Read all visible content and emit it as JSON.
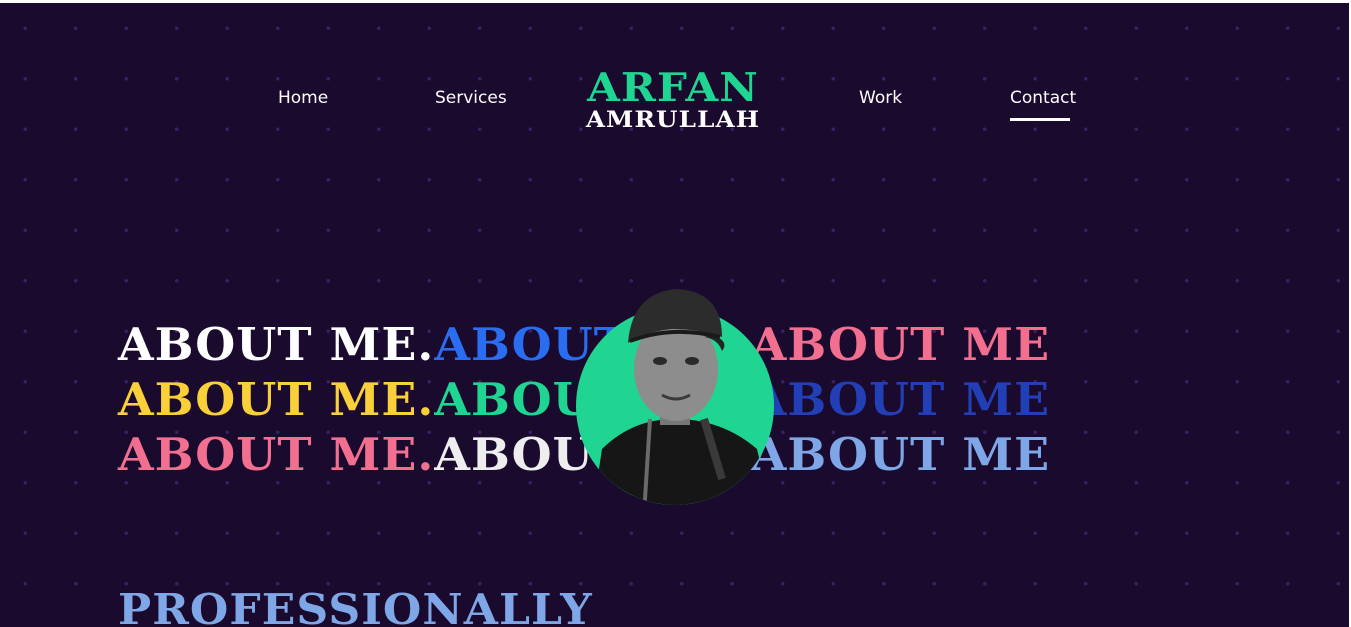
{
  "nav": {
    "links": [
      "Home",
      "Services",
      "Work",
      "Contact"
    ],
    "active": "Contact"
  },
  "logo": {
    "line1": "ARFAN",
    "line2": "AMRULLAH"
  },
  "hero": {
    "rows": [
      {
        "segments": [
          "ABOUT ME.",
          "ABOUT ME.",
          "ABOUT ME"
        ],
        "colors": [
          "#ffffff",
          "#2b6df0",
          "#f26f8f"
        ]
      },
      {
        "segments": [
          "ABOUT ME.",
          "ABOUT ME.",
          "ABOUT ME"
        ],
        "colors": [
          "#f9cf3a",
          "#1fd591",
          "#233fb8"
        ]
      },
      {
        "segments": [
          "ABOUT ME.",
          "ABOUT ME.",
          "ABOUT ME"
        ],
        "colors": [
          "#f26f8f",
          "#eeeeee",
          "#7fa6e6"
        ]
      }
    ],
    "portrait_icon": "person-portrait-photo"
  },
  "headline": "PROFESSIONALLY",
  "colors": {
    "background": "#190a2e",
    "accent": "#1fd591",
    "dot": "#3a1f63"
  }
}
